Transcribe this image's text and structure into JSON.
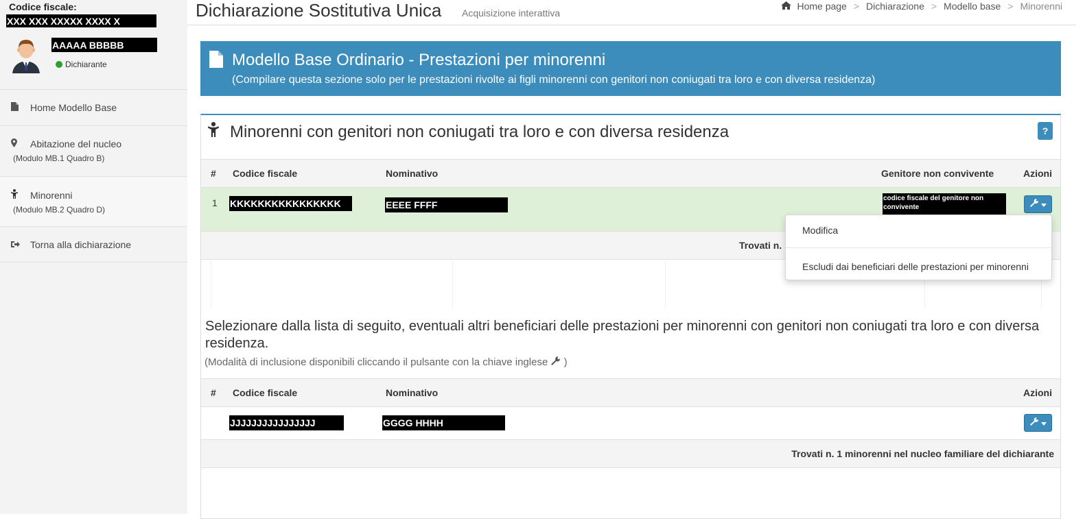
{
  "sidebar": {
    "cf_label": "Codice fiscale:",
    "cf_value": "XXX XXX XXXXX XXXX X",
    "user_name": "AAAAA BBBBB",
    "user_role": "Dichiarante",
    "items": [
      {
        "label": "Home Modello Base",
        "sub": ""
      },
      {
        "label": "Abitazione del nucleo",
        "sub": "(Modulo MB.1 Quadro B)"
      },
      {
        "label": "Minorenni",
        "sub": "(Modulo MB.2 Quadro D)"
      },
      {
        "label": "Torna alla dichiarazione",
        "sub": ""
      }
    ]
  },
  "header": {
    "title": "Dichiarazione Sostitutiva Unica",
    "subtitle": "Acquisizione interattiva",
    "breadcrumb": [
      "Home page",
      "Dichiarazione",
      "Modello base",
      "Minorenni"
    ]
  },
  "banner": {
    "title": "Modello Base Ordinario - Prestazioni per minorenni",
    "subtitle": "(Compilare questa sezione solo per le prestazioni rivolte ai figli minorenni con genitori non coniugati tra loro e con diversa residenza)"
  },
  "card": {
    "title": "Minorenni con genitori non coniugati tra loro e con diversa residenza",
    "help": "?",
    "table1": {
      "headers": [
        "#",
        "Codice fiscale",
        "Nominativo",
        "Genitore non convivente",
        "Azioni"
      ],
      "rows": [
        {
          "num": "1",
          "cf": "KKKKKKKKKKKKKKKK",
          "name": "EEEE FFFF",
          "parent": "codice fiscale del genitore non convivente"
        }
      ],
      "found": "Trovati n."
    },
    "select_text": "Selezionare dalla lista di seguito, eventuali altri beneficiari delle prestazioni per minorenni con genitori non coniugati tra loro e con diversa residenza.",
    "select_note_prefix": "(Modalità di inclusione disponibili cliccando il pulsante con la chiave inglese",
    "select_note_suffix": ")",
    "table2": {
      "headers": [
        "#",
        "Codice fiscale",
        "Nominativo",
        "Azioni"
      ],
      "rows": [
        {
          "cf": "JJJJJJJJJJJJJJJJ",
          "name": "GGGG HHHH"
        }
      ],
      "found": "Trovati n. 1 minorenni nel nucleo familiare del dichiarante"
    }
  },
  "dropdown": {
    "items": [
      "Modifica",
      "Escludi dai beneficiari delle prestazioni per minorenni"
    ]
  },
  "colors": {
    "primary": "#3c8dbc",
    "row_success": "#dff0d8",
    "sidebar_bg": "#f3f3f3",
    "status_dot": "#2ca02c"
  }
}
